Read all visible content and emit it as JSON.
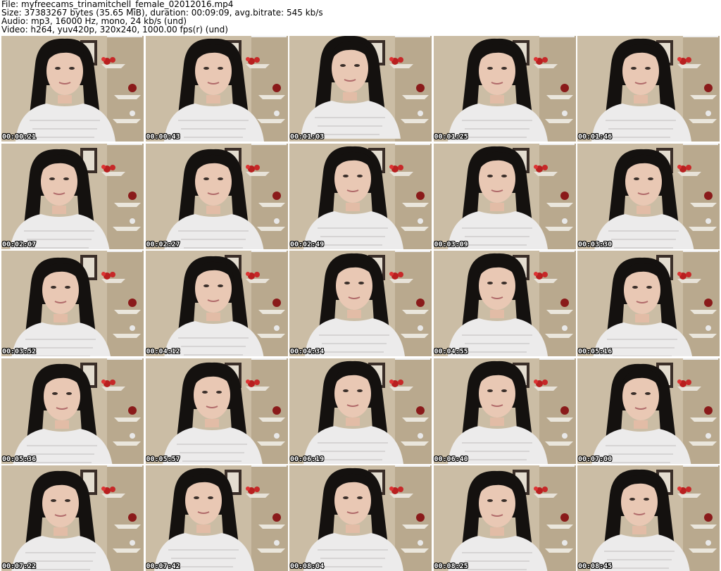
{
  "header": {
    "file": "File: myfreecams_trinamitchell_female_02012016.mp4",
    "size": "Size: 37383267 bytes (35.65 MiB), duration: 00:09:09, avg.bitrate: 545 kb/s",
    "audio": "Audio: mp3, 16000 Hz, mono, 24 kb/s (und)",
    "video": "Video: h264, yuv420p, 320x240, 1000.00 fps(r) (und)"
  },
  "thumbnails": [
    {
      "timestamp": "00:00:21"
    },
    {
      "timestamp": "00:00:43"
    },
    {
      "timestamp": "00:01:03"
    },
    {
      "timestamp": "00:01:25"
    },
    {
      "timestamp": "00:01:46"
    },
    {
      "timestamp": "00:02:07"
    },
    {
      "timestamp": "00:02:27"
    },
    {
      "timestamp": "00:02:49"
    },
    {
      "timestamp": "00:03:09"
    },
    {
      "timestamp": "00:03:30"
    },
    {
      "timestamp": "00:03:52"
    },
    {
      "timestamp": "00:04:12"
    },
    {
      "timestamp": "00:04:34"
    },
    {
      "timestamp": "00:04:55"
    },
    {
      "timestamp": "00:05:16"
    },
    {
      "timestamp": "00:05:36"
    },
    {
      "timestamp": "00:05:57"
    },
    {
      "timestamp": "00:06:19"
    },
    {
      "timestamp": "00:06:40"
    },
    {
      "timestamp": "00:07:00"
    },
    {
      "timestamp": "00:07:22"
    },
    {
      "timestamp": "00:07:42"
    },
    {
      "timestamp": "00:08:04"
    },
    {
      "timestamp": "00:08:25"
    },
    {
      "timestamp": "00:08:45"
    }
  ]
}
